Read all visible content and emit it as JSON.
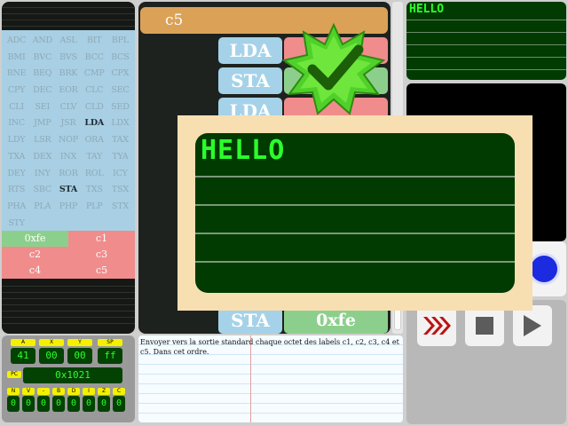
{
  "opcodes": [
    "ADC",
    "AND",
    "ASL",
    "BIT",
    "BPL",
    "BMI",
    "BVC",
    "BVS",
    "BCC",
    "BCS",
    "BNE",
    "BEQ",
    "BRK",
    "CMP",
    "CPX",
    "CPY",
    "DEC",
    "EOR",
    "CLC",
    "SEC",
    "CLI",
    "SEI",
    "CLV",
    "CLD",
    "SED",
    "INC",
    "JMP",
    "JSR",
    "LDA",
    "LDX",
    "LDY",
    "LSR",
    "NOP",
    "ORA",
    "TAX",
    "TXA",
    "DEX",
    "INX",
    "TAY",
    "TYA",
    "DEY",
    "INY",
    "ROR",
    "ROL",
    "ICY",
    "RTS",
    "SBC",
    "STA",
    "TXS",
    "TSX",
    "PHA",
    "PLA",
    "PHP",
    "PLP",
    "STX",
    "STY"
  ],
  "active_opcodes": [
    "LDA",
    "STA"
  ],
  "labels": [
    "0xfe",
    "c1",
    "c2",
    "c3",
    "c4",
    "c5"
  ],
  "center": {
    "header": "c5",
    "rows": [
      {
        "instr": "LDA",
        "arg": "",
        "color": "red"
      },
      {
        "instr": "STA",
        "arg": "",
        "color": "green"
      },
      {
        "instr": "LDA",
        "arg": "",
        "color": "red"
      },
      {
        "instr": "STA",
        "arg": "0xfe",
        "color": "green"
      }
    ]
  },
  "mini_screen": {
    "text": "HELLO"
  },
  "popup": {
    "text": "HELLO"
  },
  "registers": {
    "labels": [
      "A",
      "X",
      "Y",
      "SP"
    ],
    "values": [
      "41",
      "00",
      "00",
      "ff"
    ],
    "pc_label": "PC",
    "pc_value": "0x1021",
    "flag_labels": [
      "N",
      "V",
      "-",
      "B",
      "D",
      "I",
      "Z",
      "C"
    ],
    "flag_values": [
      "0",
      "0",
      "0",
      "0",
      "0",
      "0",
      "0",
      "0"
    ]
  },
  "notebook": {
    "text": "Envoyer vers la sortie standard chaque octet des labels c1, c2, c3, c4 et c5. Dans cet ordre."
  },
  "controls": {
    "fast_forward_icon": "fast-forward-icon",
    "stop_icon": "stop-icon",
    "play_icon": "play-icon"
  },
  "colors": {
    "screen_green": "#013b01",
    "text_green": "#2bff2b",
    "label_red": "#f08c8c",
    "label_green": "#8ccf8c",
    "instr_blue": "#a5d2e8",
    "header_orange": "#dba257"
  }
}
